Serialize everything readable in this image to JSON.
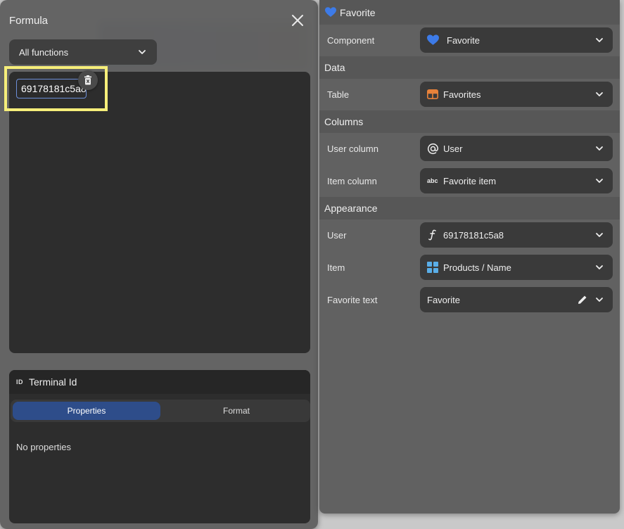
{
  "formula": {
    "title": "Formula",
    "function_filter": "All functions",
    "token": "69178181c5a8",
    "terminal": {
      "id_badge": "ID",
      "title": "Terminal Id",
      "tabs": [
        "Properties",
        "Format"
      ],
      "empty_text": "No properties"
    }
  },
  "inspector": {
    "header": "Favorite",
    "component_label": "Component",
    "component_value": "Favorite",
    "sections": {
      "data": "Data",
      "columns": "Columns",
      "appearance": "Appearance"
    },
    "table_label": "Table",
    "table_value": "Favorites",
    "user_column_label": "User column",
    "user_column_value": "User",
    "item_column_label": "Item column",
    "item_column_value": "Favorite item",
    "user_label": "User",
    "user_value": "69178181c5a8",
    "item_label": "Item",
    "item_value": "Products / Name",
    "favorite_text_label": "Favorite text",
    "favorite_text_value": "Favorite",
    "text_type_badge": "abc"
  },
  "colors": {
    "heart": "#3d7be8",
    "table_icon": "#e8823a",
    "grid_icon": "#5aaee8",
    "accent_tab": "#2e4d8a",
    "highlight": "#f6ee7a"
  }
}
